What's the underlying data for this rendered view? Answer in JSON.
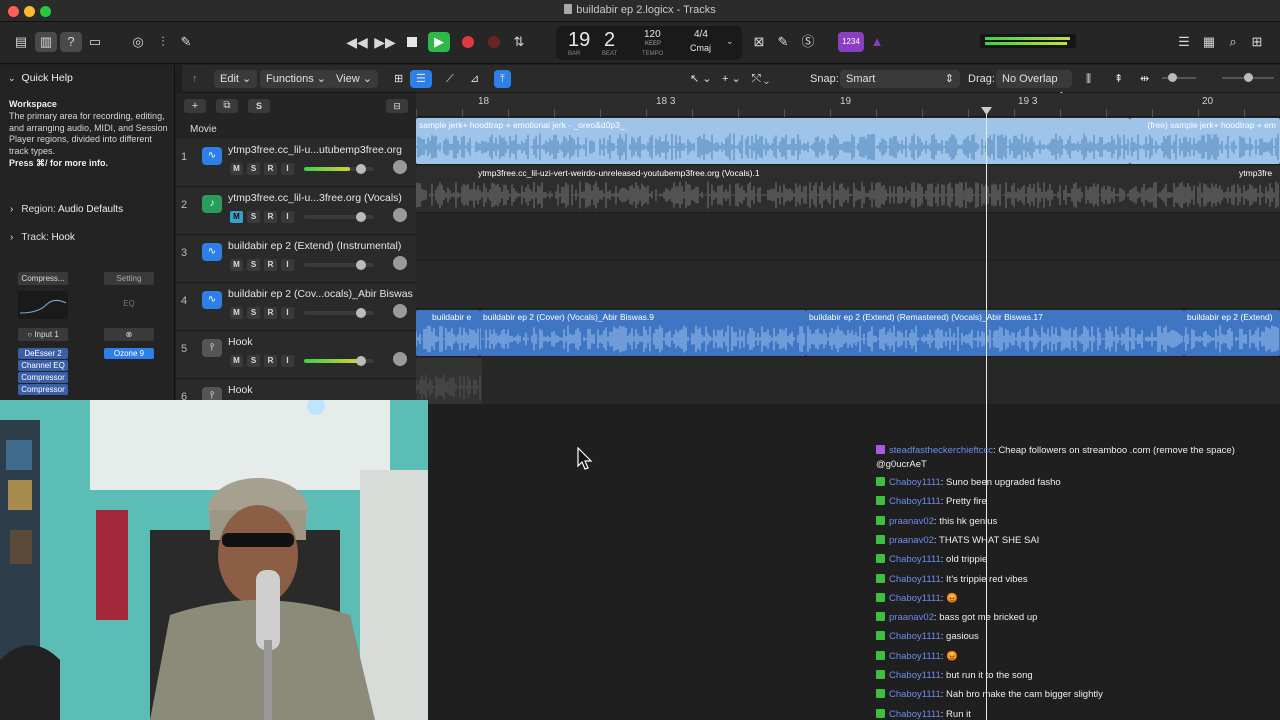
{
  "window": {
    "title": "buildabir ep 2.logicx - Tracks"
  },
  "transport": {
    "bar": "19",
    "beat": "2",
    "bar_label": "BAR",
    "beat_label": "BEAT",
    "tempo": "120",
    "tempo_mode": "KEEP",
    "tempo_label": "TEMPO",
    "signature": "4/4",
    "key": "Cmaj",
    "count_in": "1234"
  },
  "menus": {
    "edit": "Edit",
    "functions": "Functions",
    "view": "View"
  },
  "snap": {
    "label": "Snap:",
    "value": "Smart"
  },
  "drag": {
    "label": "Drag:",
    "value": "No Overlap"
  },
  "quick_help": {
    "title": "Quick Help",
    "workspace_title": "Workspace",
    "workspace_desc": "The primary area for recording, editing, and arranging audio, MIDI, and Session Player regions, divided into different track types.",
    "more_info": "Press ⌘/ for more info.",
    "region_label": "Region:",
    "region_value": "Audio Defaults",
    "track_label": "Track:",
    "track_value": "Hook"
  },
  "inspector": {
    "compressor": "Compress...",
    "setting": "Setting",
    "eq": "EQ",
    "input": "Input 1",
    "plugins": [
      "DeEsser 2",
      "Channel EQ",
      "Compressor",
      "Compressor"
    ],
    "ozone": "Ozone 9"
  },
  "tracklist": {
    "movie": "Movie",
    "header_s": "S"
  },
  "msri": [
    "M",
    "S",
    "R",
    "I"
  ],
  "tracks": [
    {
      "num": "1",
      "name": "ytmp3free.cc_lil-u...utubemp3free.org",
      "icon": "waveform-icon",
      "meter": 0.65
    },
    {
      "num": "2",
      "name": "ytmp3free.cc_lil-u...3free.org (Vocals)",
      "icon": "guitar-icon",
      "meter": 0.0
    },
    {
      "num": "3",
      "name": "buildabir ep 2 (Extend) (Instrumental)",
      "icon": "waveform-icon",
      "meter": 0.0
    },
    {
      "num": "4",
      "name": "buildabir ep 2 (Cov...ocals)_Abir Biswas",
      "icon": "waveform-icon",
      "meter": 0.0
    },
    {
      "num": "5",
      "name": "Hook",
      "icon": "microphone-icon",
      "meter": 0.8
    },
    {
      "num": "6",
      "name": "Hook",
      "icon": "microphone-icon",
      "meter": 0.0
    }
  ],
  "ruler": [
    "18",
    "18 3",
    "19",
    "19 3",
    "20"
  ],
  "regions": {
    "r1a": "sample jerk+ hoodtrap + emotional jerk - _oreo&d0p3_",
    "r1b": "(free) sample jerk+ hoodtrap + em",
    "r2": "ytmp3free.cc_lil-uzi-vert-weirdo-unreleased-youtubemp3free.org (Vocals).1",
    "r2b": "ytmp3fre",
    "r5a": "buildabir e",
    "r5b": "buildabir ep 2 (Cover) (Vocals)_Abir Biswas.9",
    "r5c": "buildabir ep 2 (Extend) (Remastered) (Vocals)_Abir Biswas.17",
    "r5d": "buildabir ep 2 (Extend)"
  },
  "chat": [
    {
      "user": "steadfastheckerchieftccc",
      "text": "Cheap followers on streamboo .com (remove the space) @g0ucrAeT",
      "badge": "purple"
    },
    {
      "user": "Chaboy1111",
      "text": "Suno been upgraded fasho"
    },
    {
      "user": "Chaboy1111",
      "text": "Pretty fire"
    },
    {
      "user": "praanav02",
      "text": "this hk genius"
    },
    {
      "user": "praanav02",
      "text": "THATS WHAT SHE SAI"
    },
    {
      "user": "Chaboy1111",
      "text": "old trippie"
    },
    {
      "user": "Chaboy1111",
      "text": "It's trippie red vibes"
    },
    {
      "user": "Chaboy1111",
      "text": "😡"
    },
    {
      "user": "praanav02",
      "text": "bass got me bricked up"
    },
    {
      "user": "Chaboy1111",
      "text": "gasious"
    },
    {
      "user": "Chaboy1111",
      "text": "😡"
    },
    {
      "user": "Chaboy1111",
      "text": "but run it to the song"
    },
    {
      "user": "Chaboy1111",
      "text": "Nah bro make the cam bigger slightly"
    },
    {
      "user": "Chaboy1111",
      "text": "Run it"
    }
  ],
  "colors": {
    "accent": "#2f7fe8",
    "audio_region": "#9ec4ea",
    "vocal_region": "#3f76c4",
    "play": "#2fb84a",
    "record": "#e0393d",
    "chat_user": "#6d8cf0",
    "chat_badge": "#3fbf3f"
  }
}
